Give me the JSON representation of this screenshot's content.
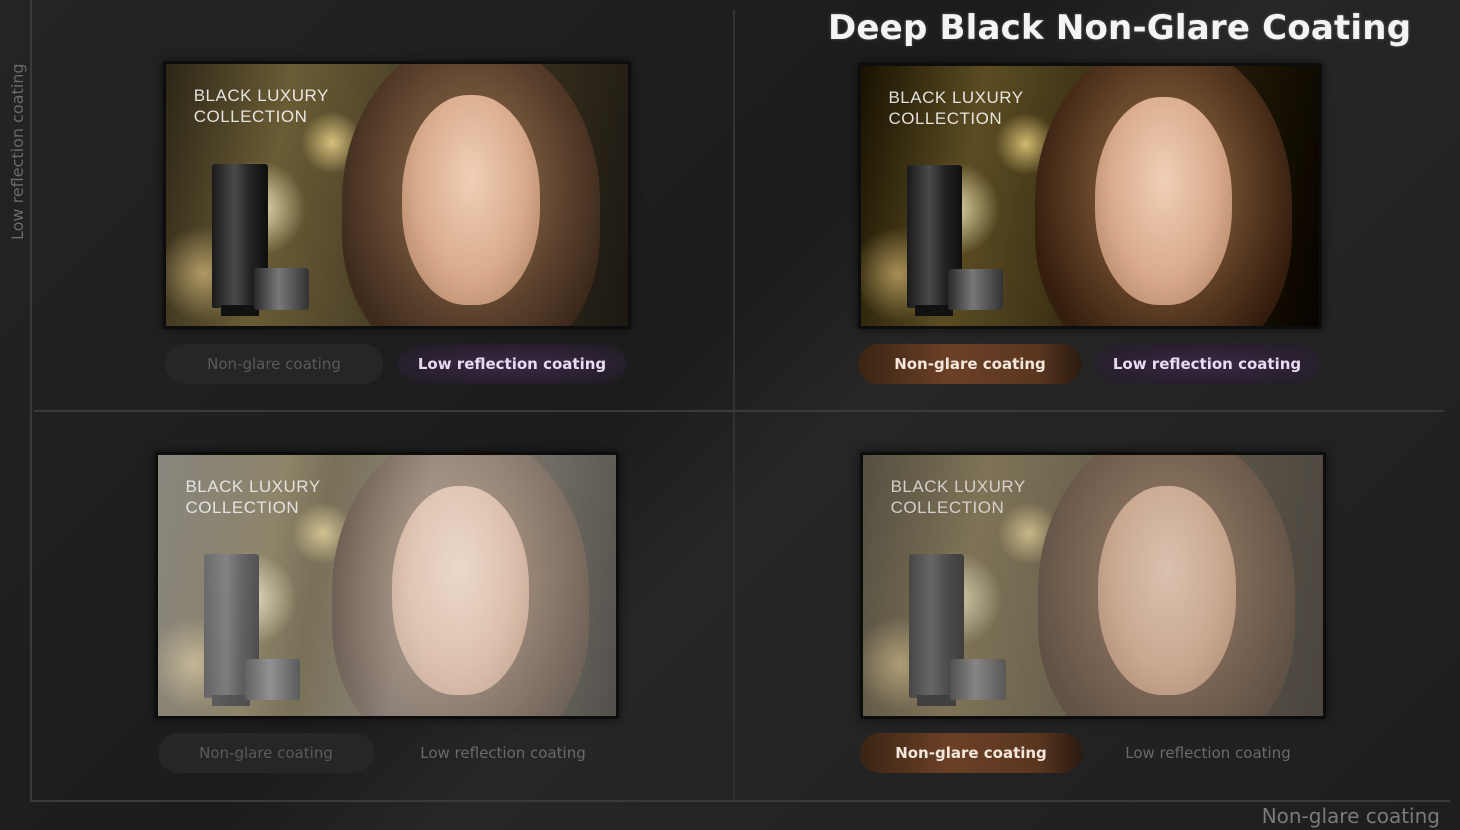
{
  "title": "Deep Black Non-Glare Coating",
  "axes": {
    "y_label": "Low reflection coating",
    "x_label": "Non-glare coating"
  },
  "panels": [
    {
      "id": "top-left",
      "brand": "BLACK LUXURY\nCOLLECTION",
      "haze": "none",
      "buttons": [
        {
          "label": "Non-glare coating",
          "state": "off"
        },
        {
          "label": "Low reflection coating",
          "state": "on"
        }
      ]
    },
    {
      "id": "top-right",
      "brand": "BLACK LUXURY\nCOLLECTION",
      "haze": "none",
      "buttons": [
        {
          "label": "Non-glare coating",
          "state": "on"
        },
        {
          "label": "Low reflection coating",
          "state": "on"
        }
      ]
    },
    {
      "id": "bottom-left",
      "brand": "BLACK LUXURY\nCOLLECTION",
      "haze": "glare",
      "buttons": [
        {
          "label": "Non-glare coating",
          "state": "off"
        },
        {
          "label": "Low reflection coating",
          "state": "off"
        }
      ]
    },
    {
      "id": "bottom-right",
      "brand": "BLACK LUXURY\nCOLLECTION",
      "haze": "flat",
      "buttons": [
        {
          "label": "Non-glare coating",
          "state": "on"
        },
        {
          "label": "Low reflection coating",
          "state": "off"
        }
      ]
    }
  ],
  "colors": {
    "background": "#1f1f1f",
    "title": "#f4f4f4",
    "low_reflection_active": "#2f2238",
    "non_glare_active": "#6b4026"
  }
}
